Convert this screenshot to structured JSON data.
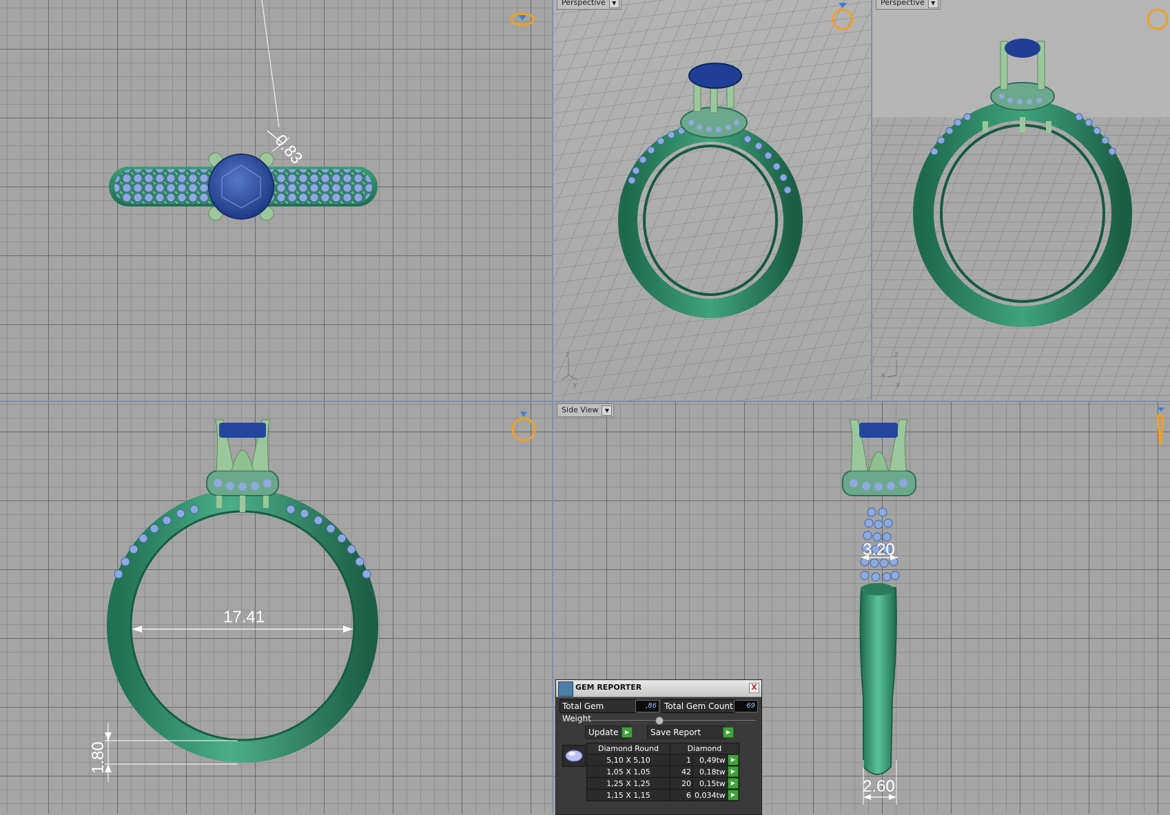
{
  "viewports": {
    "side_view_label": "Side View",
    "persp1_label": "Perspective",
    "persp2_label": "Perspective"
  },
  "dimensions": {
    "prong": "0.83",
    "inner_diameter": "17.41",
    "band_thickness": "1.80",
    "top_width": "3.20",
    "bottom_width": "2.60"
  },
  "gem_reporter": {
    "title": "GEM REPORTER",
    "close": "X",
    "total_weight_label": "Total Gem Weight",
    "total_weight_value": ",86",
    "total_count_label": "Total Gem Count",
    "total_count_value": "69",
    "update_label": "Update",
    "save_label": "Save Report",
    "col_type": "Diamond Round",
    "col_material": "Diamond",
    "rows": [
      {
        "size": "5,10 X 5,10",
        "count": "1",
        "tw": "0,49tw"
      },
      {
        "size": "1,05 X 1,05",
        "count": "42",
        "tw": "0,18tw"
      },
      {
        "size": "1,25 X 1,25",
        "count": "20",
        "tw": "0,15tw"
      },
      {
        "size": "1,15 X 1,15",
        "count": "6",
        "tw": "0,034tw"
      }
    ]
  },
  "axis": {
    "x": "x",
    "y": "y",
    "z": "z"
  },
  "colors": {
    "band": "#2f8f6c",
    "band_light": "#5cc29a",
    "prong": "#9cc79c",
    "stone": "#2b4ea3",
    "pave": "#8fa9dc",
    "ring_icon": "#f0a020"
  }
}
